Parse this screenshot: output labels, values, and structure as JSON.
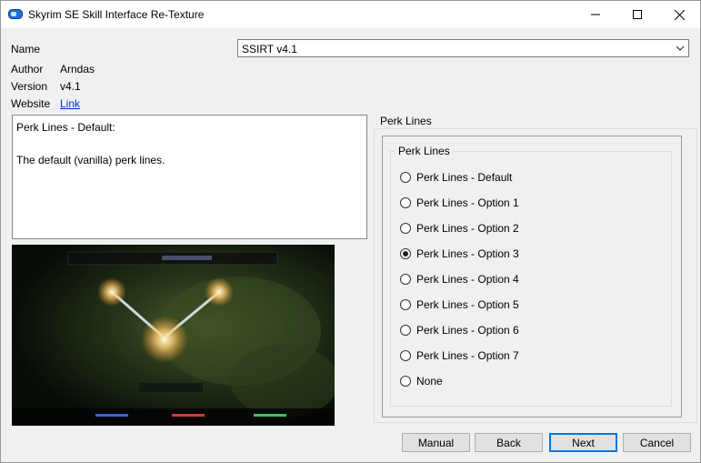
{
  "window": {
    "title": "Skyrim SE Skill Interface Re-Texture",
    "controls": [
      "minimize-icon",
      "maximize-icon",
      "close-icon"
    ]
  },
  "info": {
    "name_label": "Name",
    "name_value": "SSIRT v4.1",
    "author_label": "Author",
    "author_value": "Arndas",
    "version_label": "Version",
    "version_value": "v4.1",
    "website_label": "Website",
    "website_link": "Link"
  },
  "description": {
    "heading": "Perk Lines - Default:",
    "body": "The default (vanilla) perk lines."
  },
  "group": {
    "outer_label": "Perk Lines",
    "inner_label": "Perk Lines",
    "options": [
      {
        "label": "Perk Lines - Default",
        "checked": false
      },
      {
        "label": "Perk Lines - Option 1",
        "checked": false
      },
      {
        "label": "Perk Lines - Option 2",
        "checked": false
      },
      {
        "label": "Perk Lines - Option 3",
        "checked": true
      },
      {
        "label": "Perk Lines - Option 4",
        "checked": false
      },
      {
        "label": "Perk Lines - Option 5",
        "checked": false
      },
      {
        "label": "Perk Lines - Option 6",
        "checked": false
      },
      {
        "label": "Perk Lines - Option 7",
        "checked": false
      },
      {
        "label": "None",
        "checked": false
      }
    ]
  },
  "buttons": {
    "manual": "Manual",
    "back": "Back",
    "next": "Next",
    "cancel": "Cancel"
  },
  "colors": {
    "accent": "#0078d7",
    "link": "#0033cc"
  }
}
